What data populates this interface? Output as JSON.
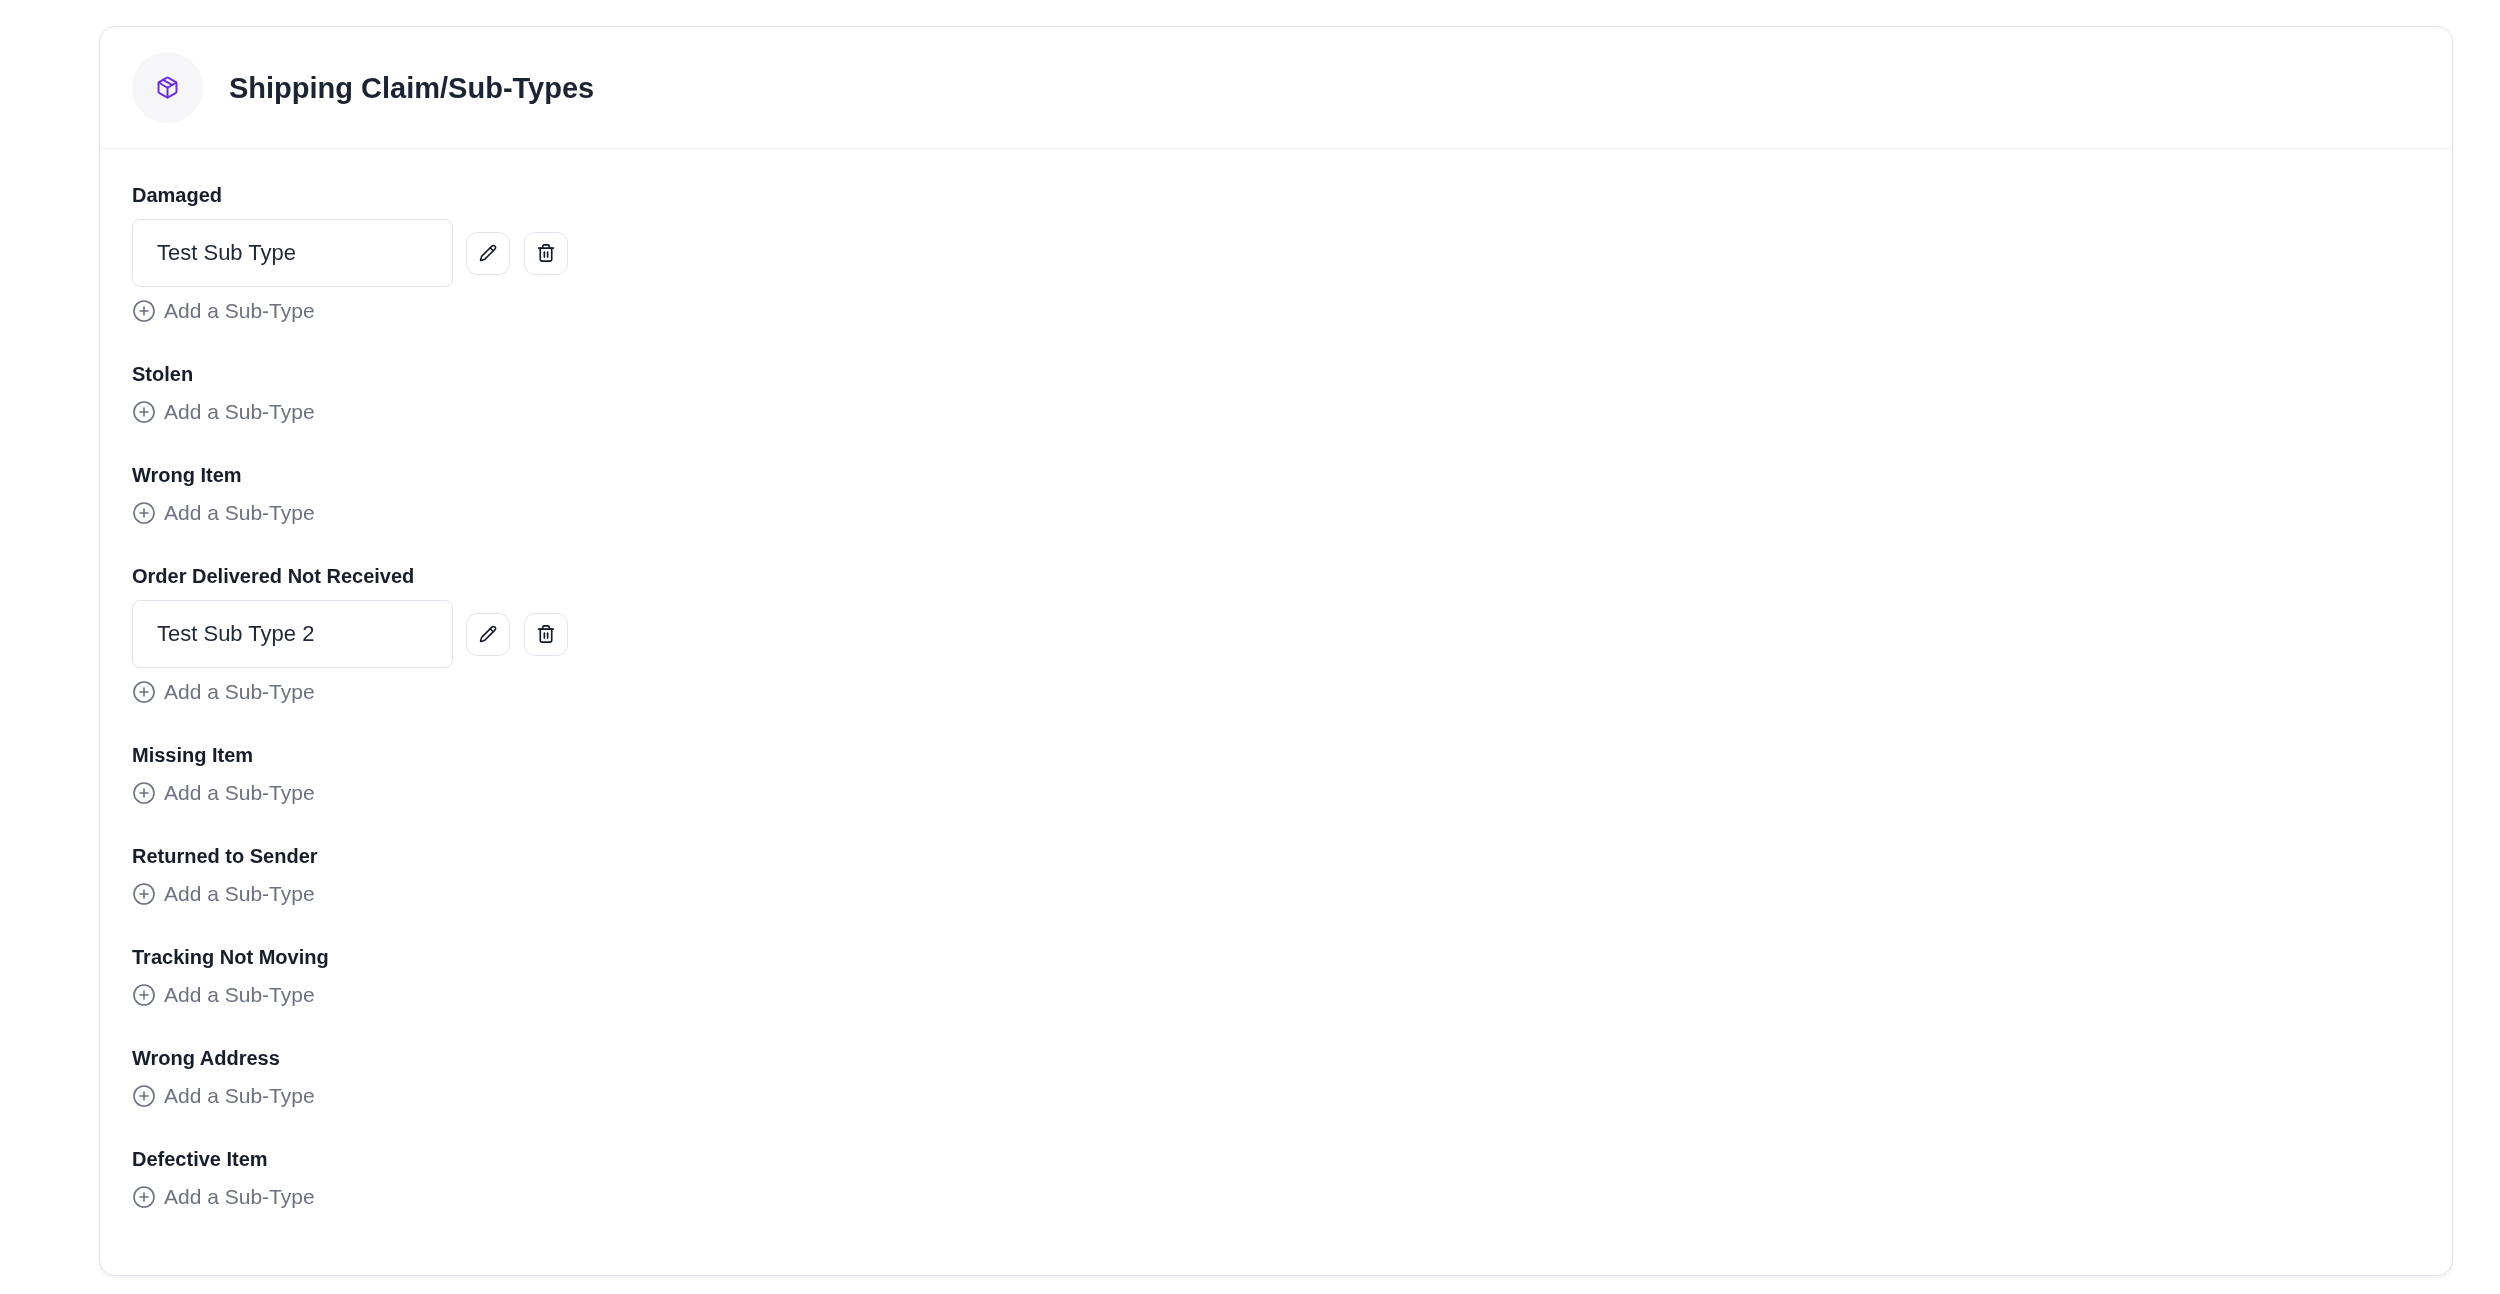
{
  "panel": {
    "title": "Shipping Claim/Sub-Types"
  },
  "claim_types": [
    {
      "name": "Damaged",
      "sub_types": [
        "Test Sub Type"
      ],
      "add_label": "Add a Sub-Type"
    },
    {
      "name": "Stolen",
      "add_label": "Add a Sub-Type"
    },
    {
      "name": "Wrong Item",
      "add_label": "Add a Sub-Type"
    },
    {
      "name": "Order Delivered Not Received",
      "sub_types": [
        "Test Sub Type 2"
      ],
      "add_label": "Add a Sub-Type"
    },
    {
      "name": "Missing Item",
      "add_label": "Add a Sub-Type"
    },
    {
      "name": "Returned to Sender",
      "add_label": "Add a Sub-Type"
    },
    {
      "name": "Tracking Not Moving",
      "add_label": "Add a Sub-Type"
    },
    {
      "name": "Wrong Address",
      "add_label": "Add a Sub-Type"
    },
    {
      "name": "Defective Item",
      "add_label": "Add a Sub-Type"
    }
  ]
}
